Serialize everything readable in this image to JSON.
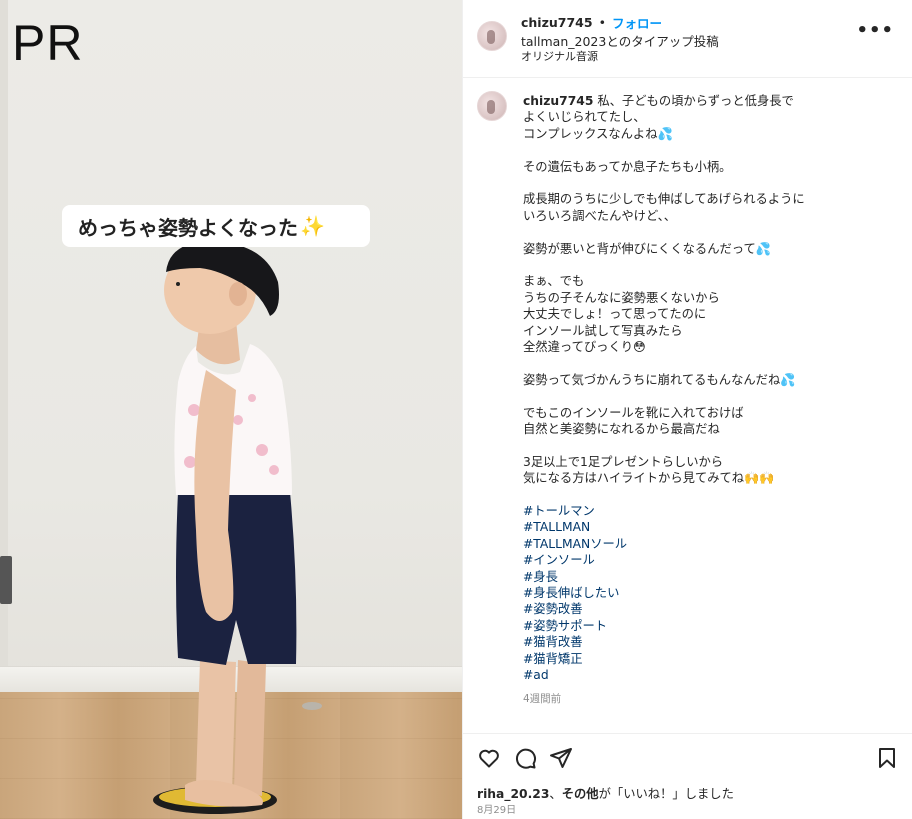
{
  "media": {
    "pr_label": "PR",
    "caption_text": "めっちゃ姿勢よくなった",
    "caption_emoji": "✨"
  },
  "header": {
    "username": "chizu7745",
    "separator": "•",
    "follow_label": "フォロー",
    "tie_up": "tallman_2023とのタイアップ投稿",
    "audio": "オリジナル音源",
    "more_label": "•••"
  },
  "post": {
    "username": "chizu7745",
    "paragraphs": [
      "私、子どもの頃からずっと低身長で\nよくいじられてたし、\nコンプレックスなんよね💦",
      "その遺伝もあってか息子たちも小柄。",
      "成長期のうちに少しでも伸ばしてあげられるように\nいろいろ調べたんやけど、、",
      "姿勢が悪いと背が伸びにくくなるんだって💦",
      "まぁ、でも\nうちの子そんなに姿勢悪くないから\n大丈夫でしょ！って思ってたのに\nインソール試して写真みたら\n全然違ってびっくり😳",
      "姿勢って気づかんうちに崩れてるもんなんだね💦",
      "でもこのインソールを靴に入れておけば\n自然と美姿勢になれるから最高だね",
      "3足以上で1足プレゼントらしいから\n気になる方はハイライトから見てみてね🙌🙌"
    ],
    "hashtags": [
      "#トールマン",
      "#TALLMAN",
      "#TALLMANソール",
      "#インソール",
      "#身長",
      "#身長伸ばしたい",
      "#姿勢改善",
      "#姿勢サポート",
      "#猫背改善",
      "#猫背矯正",
      "#ad"
    ],
    "time_ago": "4週間前"
  },
  "footer": {
    "liker": "riha_20.23",
    "likes_mid": "、",
    "others": "その他",
    "likes_suffix": "が「いいね！」しました",
    "date": "8月29日"
  }
}
